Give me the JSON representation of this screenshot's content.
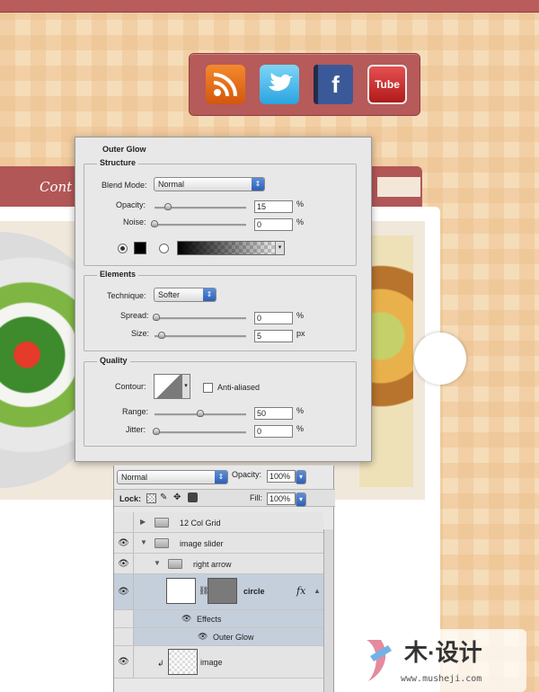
{
  "colors": {
    "accent_red": "#b85c5c",
    "background": "#f5ddb9",
    "selected_layer": "#c5cfdb"
  },
  "website": {
    "social_icons": [
      {
        "name": "rss-icon",
        "label": ""
      },
      {
        "name": "twitter-bird-icon",
        "label": ""
      },
      {
        "name": "facebook-book-icon",
        "label": "f"
      },
      {
        "name": "youtube-tv-icon",
        "label": "Tube"
      }
    ],
    "contact_label": "Cont"
  },
  "outer_glow": {
    "title": "Outer Glow",
    "structure": {
      "legend": "Structure",
      "blend_mode_label": "Blend Mode:",
      "blend_mode": "Normal",
      "opacity_label": "Opacity:",
      "opacity": "15",
      "opacity_percent": 15,
      "opacity_unit": "%",
      "noise_label": "Noise:",
      "noise": "0",
      "noise_percent": 0,
      "noise_unit": "%",
      "color_mode": "solid"
    },
    "elements": {
      "legend": "Elements",
      "technique_label": "Technique:",
      "technique": "Softer",
      "spread_label": "Spread:",
      "spread": "0",
      "spread_unit": "%",
      "size_label": "Size:",
      "size": "5",
      "size_unit": "px"
    },
    "quality": {
      "legend": "Quality",
      "contour_label": "Contour:",
      "anti_aliased_label": "Anti-aliased",
      "anti_aliased": false,
      "range_label": "Range:",
      "range": "50",
      "range_percent": 50,
      "range_unit": "%",
      "jitter_label": "Jitter:",
      "jitter": "0",
      "jitter_unit": "%"
    }
  },
  "layers": {
    "blend_mode": "Normal",
    "opacity_label": "Opacity:",
    "opacity": "100%",
    "lock_label": "Lock:",
    "fill_label": "Fill:",
    "fill": "100%",
    "items": [
      {
        "name": "12 Col Grid"
      },
      {
        "name": "image slider"
      },
      {
        "name": "right arrow"
      },
      {
        "name": "circle",
        "fx": "fx"
      },
      {
        "name": "Effects"
      },
      {
        "name": "Outer Glow"
      },
      {
        "name": "image"
      }
    ]
  },
  "watermark": {
    "brand": "木·设计",
    "url": "www.musheji.com"
  }
}
